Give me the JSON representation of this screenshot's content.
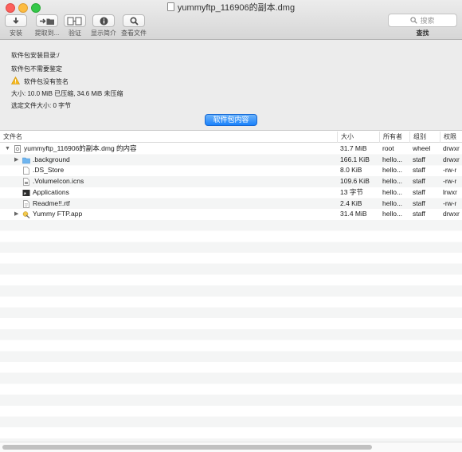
{
  "window": {
    "title": "yummyftp_116906的副本.dmg"
  },
  "toolbar": {
    "buttons": [
      {
        "label": "安装",
        "icon": "download-arrow-icon"
      },
      {
        "label": "提取到...",
        "icon": "extract-to-folder-icon"
      },
      {
        "label": "验证",
        "icon": "verify-icon"
      },
      {
        "label": "显示简介",
        "icon": "info-icon"
      },
      {
        "label": "查看文件",
        "icon": "search-icon"
      }
    ],
    "search": {
      "placeholder": "搜索",
      "label": "查找"
    }
  },
  "info": {
    "install_dir": "软件包安装目录:/",
    "auth": "软件包不需要鉴定",
    "signature": "软件包没有签名",
    "size": "大小: 10.0 MiB 已压缩, 34.6 MiB 未压缩",
    "selected_size": "选定文件大小: 0 字节",
    "contents_button": "软件包内容"
  },
  "table": {
    "columns": [
      "文件名",
      "大小",
      "所有者",
      "组别",
      "权限"
    ],
    "rows": [
      {
        "name": "yummyftp_116906的副本.dmg 的内容",
        "size": "31.7 MiB",
        "owner": "root",
        "group": "wheel",
        "perm": "drwxr",
        "icon": "disk-image-icon",
        "expanded": true
      },
      {
        "name": ".background",
        "size": "166.1 KiB",
        "owner": "hello...",
        "group": "staff",
        "perm": "drwxr",
        "icon": "folder-icon",
        "collapsed": true
      },
      {
        "name": ".DS_Store",
        "size": "8.0 KiB",
        "owner": "hello...",
        "group": "staff",
        "perm": "-rw-r",
        "icon": "document-icon"
      },
      {
        "name": ".VolumeIcon.icns",
        "size": "109.6 KiB",
        "owner": "hello...",
        "group": "staff",
        "perm": "-rw-r",
        "icon": "icns-file-icon"
      },
      {
        "name": "Applications",
        "size": "13 字节",
        "owner": "hello...",
        "group": "staff",
        "perm": "lrwxr",
        "icon": "alias-icon"
      },
      {
        "name": "Readme!!.rtf",
        "size": "2.4 KiB",
        "owner": "hello...",
        "group": "staff",
        "perm": "-rw-r",
        "icon": "rtf-document-icon"
      },
      {
        "name": "Yummy FTP.app",
        "size": "31.4 MiB",
        "owner": "hello...",
        "group": "staff",
        "perm": "drwxr",
        "icon": "app-icon",
        "collapsed": true
      }
    ]
  }
}
